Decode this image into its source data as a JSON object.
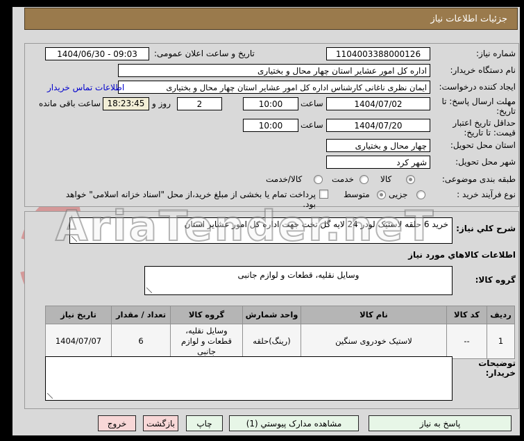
{
  "header": {
    "title": "جزئیات اطلاعات نیاز"
  },
  "colors": {
    "header_brown": "#9a7a4c",
    "button_green": "#e7f6e7",
    "button_pink": "#f8d7d7",
    "link_blue": "#0000cc",
    "countdown_bg": "#f2eed6",
    "watermark_red": "#cc2222"
  },
  "fields": {
    "need_number": {
      "label": "شماره نیاز:",
      "value": "1104003388000126"
    },
    "announce": {
      "label": "تاریخ و ساعت اعلان عمومی:",
      "value": "1404/06/30 - 09:03"
    },
    "buyer_org": {
      "label": "نام دستگاه خریدار:",
      "value": "اداره کل امور عشایر استان چهار محال و بختیاری"
    },
    "creator": {
      "label": "ایجاد کننده درخواست:",
      "value": "ایمان نظری ناغانی کارشناس اداره کل امور عشایر استان چهار محال و بختیاری",
      "contact_link": "اطلاعات تماس خریدار"
    },
    "deadline": {
      "label": "مهلت ارسال پاسخ: تا تاریخ:",
      "date": "1404/07/02",
      "hour_label": "ساعت",
      "hour": "10:00",
      "days": "2",
      "days_label": "روز و",
      "countdown": "18:23:45",
      "countdown_label": "ساعت باقی مانده"
    },
    "price_validity": {
      "label": "حداقل تاریخ اعتبار قیمت: تا تاریخ:",
      "date": "1404/07/20",
      "hour_label": "ساعت",
      "hour": "10:00"
    },
    "province": {
      "label": "استان محل تحویل:",
      "value": "چهار محال و بختیاری"
    },
    "city": {
      "label": "شهر محل تحویل:",
      "value": "شهر کرد"
    },
    "classification": {
      "label": "طبقه بندی موضوعی:",
      "options": [
        {
          "label": "کالا",
          "selected": true
        },
        {
          "label": "خدمت",
          "selected": false
        },
        {
          "label": "کالا/خدمت",
          "selected": false
        }
      ]
    },
    "process_type": {
      "label": "نوع فرآیند خرید :",
      "options": [
        {
          "label": "جزیی",
          "selected": false
        },
        {
          "label": "متوسط",
          "selected": true
        }
      ],
      "treasury_checkbox_label": "پرداخت تمام یا بخشی از مبلغ خرید،از محل \"اسناد خزانه اسلامی\" خواهد بود."
    }
  },
  "need_section": {
    "desc_label": "شرح کلي نیاز:",
    "desc_value": "خرید 6 حلقه لاستیک لودر 24 لایه گل تخت جهت اداره کل امور عشایر استان",
    "items_title": "اطلاعات کالاهاي مورد نیاز",
    "group_label": "گروه کالا:",
    "group_value": "وسایل نقلیه، قطعات و لوازم جانبی",
    "table": {
      "headers": [
        "ردیف",
        "کد کالا",
        "نام کالا",
        "واحد شمارش",
        "گروه کالا",
        "تعداد / مقدار",
        "تاریخ نیاز"
      ],
      "rows": [
        [
          "1",
          "--",
          "لاستیک خودروی سنگین",
          "(رینگ)حلقه",
          "وسایل نقلیه، قطعات و لوازم جانبی",
          "6",
          "1404/07/07"
        ]
      ]
    },
    "buyer_notes_label": "توضیحات خریدار:",
    "buyer_notes_value": ""
  },
  "buttons": {
    "respond": "پاسخ به نیاز",
    "attach_docs": "مشاهده مدارک پیوستي (1)",
    "print": "چاپ",
    "back": "بازگشت",
    "exit": "خروج"
  },
  "watermark": {
    "text": "AriaTender.neT"
  }
}
